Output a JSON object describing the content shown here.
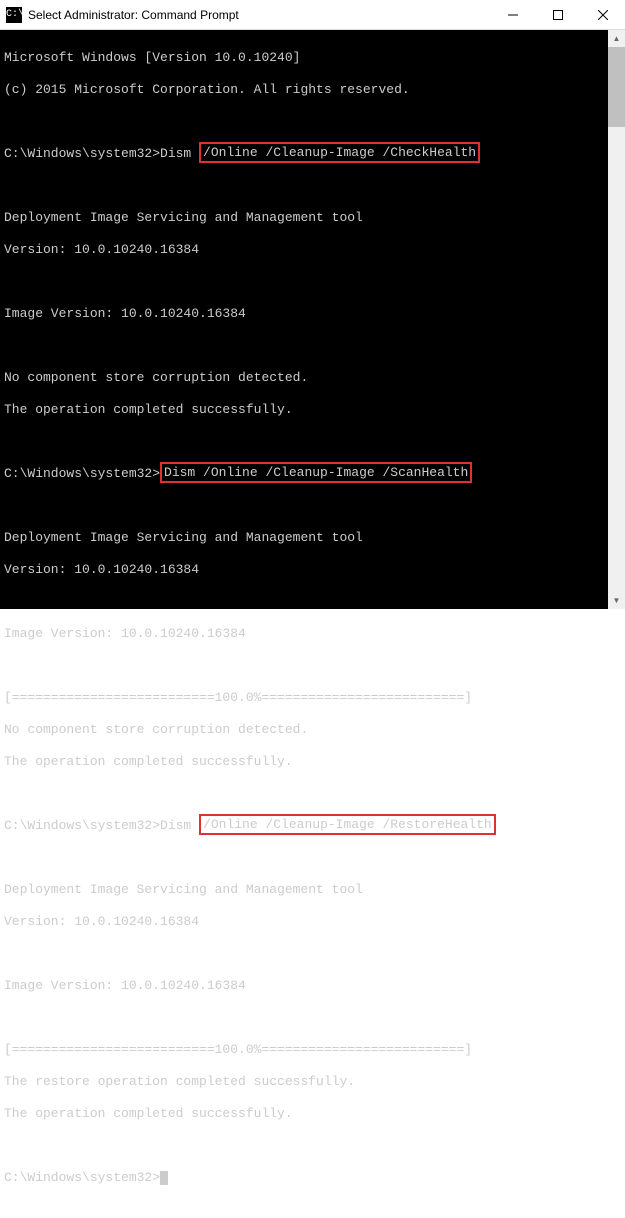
{
  "titlebar": {
    "icon_text": "C:\\",
    "title": "Select Administrator: Command Prompt"
  },
  "console": {
    "lines": {
      "l1": "Microsoft Windows [Version 10.0.10240]",
      "l2": "(c) 2015 Microsoft Corporation. All rights reserved.",
      "l3": "",
      "l4_prefix": "C:\\Windows\\system32>Dism ",
      "l4_hl": "/Online /Cleanup-Image /CheckHealth",
      "l5": "",
      "l6": "Deployment Image Servicing and Management tool",
      "l7": "Version: 10.0.10240.16384",
      "l8": "",
      "l9": "Image Version: 10.0.10240.16384",
      "l10": "",
      "l11": "No component store corruption detected.",
      "l12": "The operation completed successfully.",
      "l13": "",
      "l14_prefix": "C:\\Windows\\system32>",
      "l14_hl": "Dism /Online /Cleanup-Image /ScanHealth",
      "l15": "",
      "l16": "Deployment Image Servicing and Management tool",
      "l17": "Version: 10.0.10240.16384",
      "l18": "",
      "l19": "Image Version: 10.0.10240.16384",
      "l20": "",
      "l21": "[==========================100.0%==========================]",
      "l22": "No component store corruption detected.",
      "l23": "The operation completed successfully.",
      "l24": "",
      "l25_prefix": "C:\\Windows\\system32>Dism ",
      "l25_hl": "/Online /Cleanup-Image /RestoreHealth",
      "l26": "",
      "l27": "Deployment Image Servicing and Management tool",
      "l28": "Version: 10.0.10240.16384",
      "l29": "",
      "l30": "Image Version: 10.0.10240.16384",
      "l31": "",
      "l32": "[==========================100.0%==========================]",
      "l33": "The restore operation completed successfully.",
      "l34": "The operation completed successfully.",
      "l35": "",
      "l36": "C:\\Windows\\system32>"
    }
  }
}
